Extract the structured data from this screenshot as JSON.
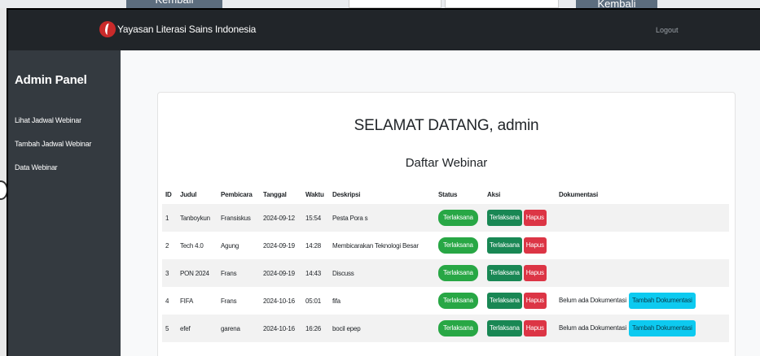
{
  "background": {
    "btn1_label": "Kembali",
    "btn2_label": "Kembali"
  },
  "navbar": {
    "brand": "Yayasan Literasi Sains Indonesia",
    "logout": "Logout"
  },
  "sidebar": {
    "title": "Admin Panel",
    "items": [
      {
        "label": "Lihat Jadwal Webinar"
      },
      {
        "label": "Tambah Jadwal Webinar"
      },
      {
        "label": "Data Webinar"
      }
    ]
  },
  "main": {
    "welcome": "SELAMAT DATANG, admin",
    "list_title": "Daftar Webinar",
    "columns": [
      "ID",
      "Judul",
      "Pembicara",
      "Tanggal",
      "Waktu",
      "Deskripsi",
      "Status",
      "Aksi",
      "Dokumentasi"
    ],
    "rows": [
      {
        "id": "1",
        "judul": "Tanboykun",
        "pembicara": "Fransiskus",
        "tanggal": "2024-09-12",
        "waktu": "15:54",
        "deskripsi": "Pesta Pora s",
        "status": "Terlaksana",
        "aksi_primary": "Terlaksana",
        "aksi_delete": "Hapus",
        "dok_text": "",
        "dok_button": ""
      },
      {
        "id": "2",
        "judul": "Tech 4.0",
        "pembicara": "Agung",
        "tanggal": "2024-09-19",
        "waktu": "14:28",
        "deskripsi": "Membicarakan Teknologi Besar",
        "status": "Terlaksana",
        "aksi_primary": "Terlaksana",
        "aksi_delete": "Hapus",
        "dok_text": "",
        "dok_button": ""
      },
      {
        "id": "3",
        "judul": "PON 2024",
        "pembicara": "Frans",
        "tanggal": "2024-09-19",
        "waktu": "14:43",
        "deskripsi": "Discuss",
        "status": "Terlaksana",
        "aksi_primary": "Terlaksana",
        "aksi_delete": "Hapus",
        "dok_text": "",
        "dok_button": ""
      },
      {
        "id": "4",
        "judul": "FIFA",
        "pembicara": "Frans",
        "tanggal": "2024-10-16",
        "waktu": "05:01",
        "deskripsi": "fifa",
        "status": "Terlaksana",
        "aksi_primary": "Terlaksana",
        "aksi_delete": "Hapus",
        "dok_text": "Belum ada Dokumentasi",
        "dok_button": "Tambah Dokumentasi"
      },
      {
        "id": "5",
        "judul": "efef",
        "pembicara": "garena",
        "tanggal": "2024-10-16",
        "waktu": "16:26",
        "deskripsi": "bocil epep",
        "status": "Terlaksana",
        "aksi_primary": "Terlaksana",
        "aksi_delete": "Hapus",
        "dok_text": "Belum ada Dokumentasi",
        "dok_button": "Tambah Dokumentasi"
      }
    ]
  },
  "colors": {
    "navbar": "#212529",
    "sidebar": "#343a40",
    "status_badge": "#28a745",
    "success_button": "#198754",
    "danger_button": "#dc3545",
    "info_button": "#0dcaf0"
  }
}
